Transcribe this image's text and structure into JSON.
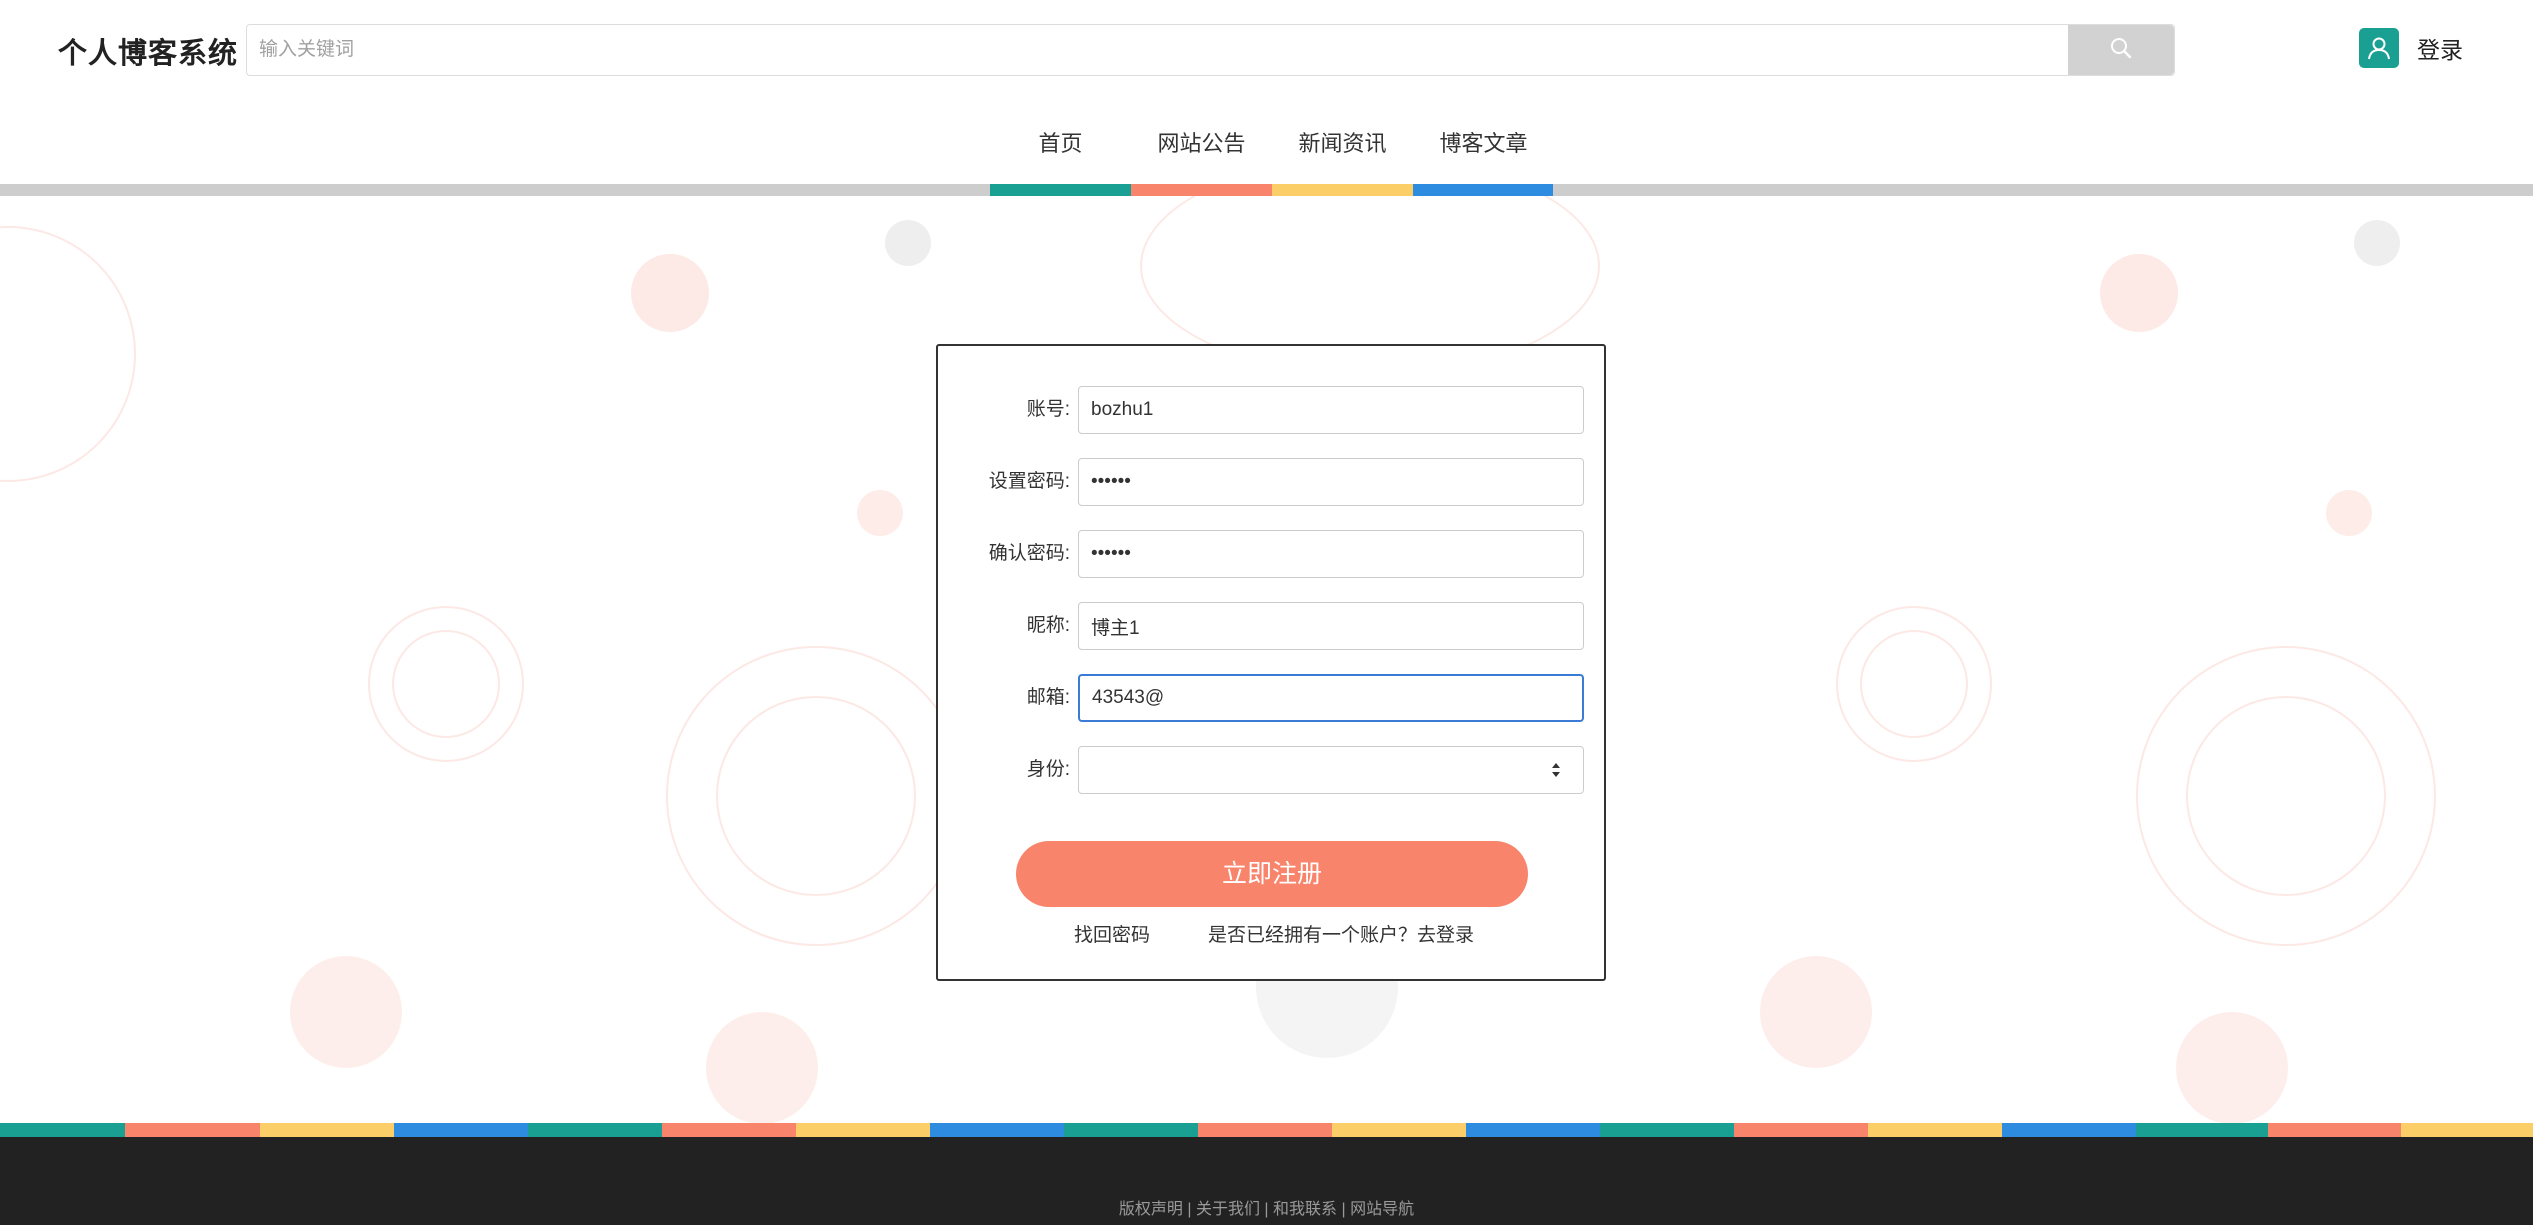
{
  "header": {
    "site_title": "个人博客系统",
    "search_placeholder": "输入关键词",
    "search_icon": "search-icon",
    "login_icon": "user-icon",
    "login_label": "登录"
  },
  "nav": {
    "items": [
      {
        "label": "首页",
        "color": "#1aa092"
      },
      {
        "label": "网站公告",
        "color": "#f8846c"
      },
      {
        "label": "新闻资讯",
        "color": "#fcce68"
      },
      {
        "label": "博客文章",
        "color": "#2e8ce0"
      }
    ]
  },
  "form": {
    "fields": [
      {
        "label": "账号:",
        "value": "bozhu1",
        "type": "text"
      },
      {
        "label": "设置密码:",
        "value": "••••••",
        "type": "password"
      },
      {
        "label": "确认密码:",
        "value": "••••••",
        "type": "password"
      },
      {
        "label": "昵称:",
        "value": "博主1",
        "type": "text"
      },
      {
        "label": "邮箱:",
        "value": "43543@",
        "type": "text",
        "focused": true
      },
      {
        "label": "身份:",
        "value": "",
        "type": "select"
      }
    ],
    "submit_label": "立即注册",
    "forgot_label": "找回密码",
    "have_account_label": "是否已经拥有一个账户？去登录"
  },
  "footer": {
    "links_text": "版权声明 | 关于我们 | 和我联系 | 网站导航"
  },
  "colors": {
    "teal": "#1aa092",
    "coral": "#f8846c",
    "yellow": "#fcce68",
    "blue": "#2e8ce0",
    "footer_bg": "#222222"
  }
}
